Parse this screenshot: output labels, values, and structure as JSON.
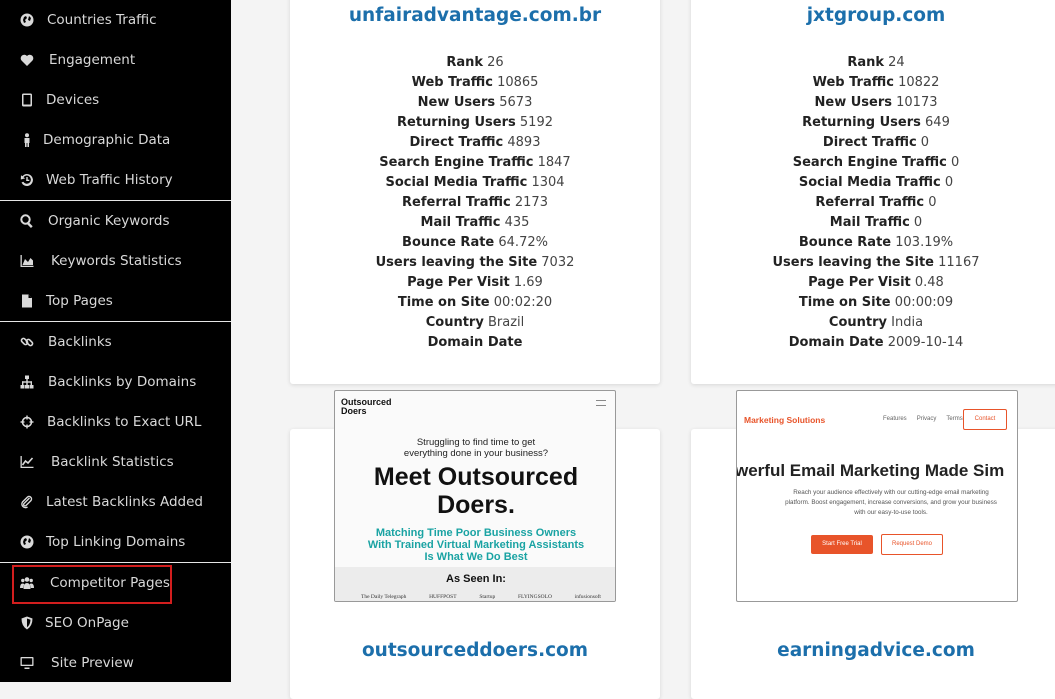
{
  "sidebar": {
    "items": [
      {
        "label": "Countries Traffic",
        "icon": "globe-icon"
      },
      {
        "label": "Engagement",
        "icon": "heart-icon"
      },
      {
        "label": "Devices",
        "icon": "tablet-icon"
      },
      {
        "label": "Demographic Data",
        "icon": "person-icon"
      },
      {
        "label": "Web Traffic History",
        "icon": "history-icon"
      },
      {
        "label": "Organic Keywords",
        "icon": "search-icon"
      },
      {
        "label": "Keywords Statistics",
        "icon": "area-chart-icon"
      },
      {
        "label": "Top Pages",
        "icon": "file-icon"
      },
      {
        "label": "Backlinks",
        "icon": "link-icon"
      },
      {
        "label": "Backlinks by Domains",
        "icon": "sitemap-icon"
      },
      {
        "label": "Backlinks to Exact URL",
        "icon": "crosshairs-icon"
      },
      {
        "label": "Backlink Statistics",
        "icon": "line-chart-icon"
      },
      {
        "label": "Latest Backlinks Added",
        "icon": "paperclip-icon"
      },
      {
        "label": "Top Linking Domains",
        "icon": "globe-icon"
      },
      {
        "label": "Competitor Pages",
        "icon": "users-icon"
      },
      {
        "label": "SEO OnPage",
        "icon": "shield-icon"
      },
      {
        "label": "Site Preview",
        "icon": "monitor-icon"
      }
    ]
  },
  "cards": [
    {
      "domain": "unfairadvantage.com.br",
      "stats": [
        {
          "k": "Rank",
          "v": "26"
        },
        {
          "k": "Web Traffic",
          "v": "10865"
        },
        {
          "k": "New Users",
          "v": "5673"
        },
        {
          "k": "Returning Users",
          "v": "5192"
        },
        {
          "k": "Direct Traffic",
          "v": "4893"
        },
        {
          "k": "Search Engine Traffic",
          "v": "1847"
        },
        {
          "k": "Social Media Traffic",
          "v": "1304"
        },
        {
          "k": "Referral Traffic",
          "v": "2173"
        },
        {
          "k": "Mail Traffic",
          "v": "435"
        },
        {
          "k": "Bounce Rate",
          "v": "64.72%"
        },
        {
          "k": "Users leaving the Site",
          "v": "7032"
        },
        {
          "k": "Page Per Visit",
          "v": "1.69"
        },
        {
          "k": "Time on Site",
          "v": "00:02:20"
        },
        {
          "k": "Country",
          "v": "Brazil"
        },
        {
          "k": "Domain Date",
          "v": ""
        }
      ]
    },
    {
      "domain": "jxtgroup.com",
      "stats": [
        {
          "k": "Rank",
          "v": "24"
        },
        {
          "k": "Web Traffic",
          "v": "10822"
        },
        {
          "k": "New Users",
          "v": "10173"
        },
        {
          "k": "Returning Users",
          "v": "649"
        },
        {
          "k": "Direct Traffic",
          "v": "0"
        },
        {
          "k": "Search Engine Traffic",
          "v": "0"
        },
        {
          "k": "Social Media Traffic",
          "v": "0"
        },
        {
          "k": "Referral Traffic",
          "v": "0"
        },
        {
          "k": "Mail Traffic",
          "v": "0"
        },
        {
          "k": "Bounce Rate",
          "v": "103.19%"
        },
        {
          "k": "Users leaving the Site",
          "v": "11167"
        },
        {
          "k": "Page Per Visit",
          "v": "0.48"
        },
        {
          "k": "Time on Site",
          "v": "00:00:09"
        },
        {
          "k": "Country",
          "v": "India"
        },
        {
          "k": "Domain Date",
          "v": "2009-10-14"
        }
      ]
    }
  ],
  "previews": [
    {
      "domain": "outsourceddoers.com",
      "logo_line1": "Outsourced",
      "logo_line2": "Doers",
      "tagline": "Struggling to find time to get everything done in your business?",
      "headline": "Meet Outsourced Doers.",
      "sub": "Matching Time Poor Business Owners With Trained Virtual Marketing Assistants Is What We Do Best",
      "seen_in": "As Seen In:",
      "logos": [
        "The Daily Telegraph",
        "HUFFPOST",
        "Startup",
        "FLYINGSOLO",
        "infusionsoft"
      ]
    },
    {
      "domain": "earningadvice.com",
      "brand": "Marketing Solutions",
      "nav": [
        "Features",
        "Privacy",
        "Terms"
      ],
      "contact": "Contact",
      "headline": "werful Email Marketing Made Sim",
      "body": "Reach your audience effectively with our cutting-edge email marketing platform. Boost engagement, increase conversions, and grow your business with our easy-to-use tools.",
      "cta_primary": "Start Free Trial",
      "cta_secondary": "Request Demo"
    }
  ],
  "colors": {
    "link": "#1c6fab",
    "highlight": "#d21e1e",
    "teal": "#1aa3a3",
    "orange": "#e8542a"
  }
}
